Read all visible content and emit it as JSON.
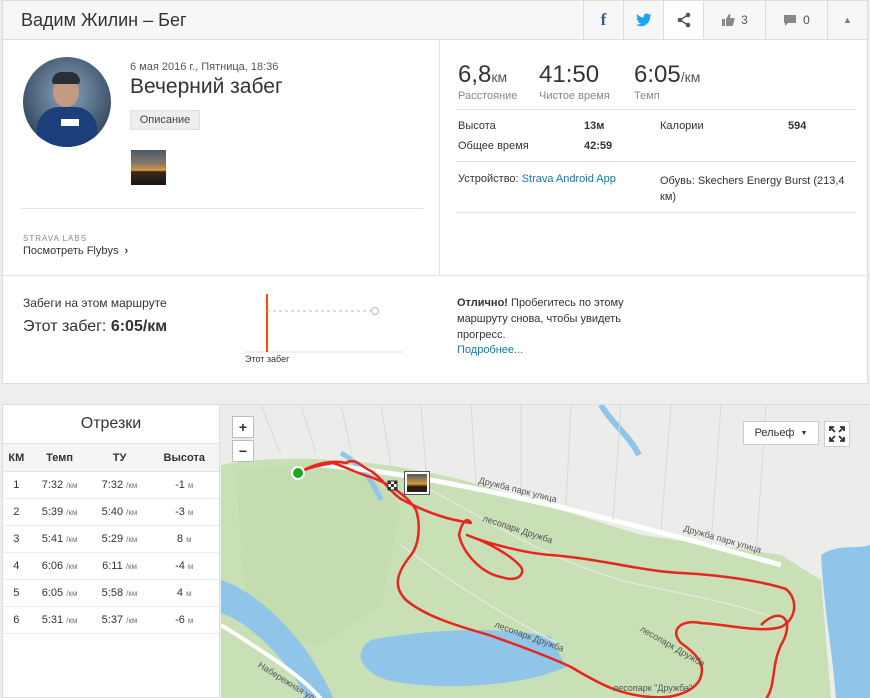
{
  "header": {
    "title": "Вадим Жилин – Бег",
    "kudos_count": "3",
    "comments_count": "0"
  },
  "activity": {
    "date": "6 мая 2016 г., Пятница, 18:36",
    "name": "Вечерний забег",
    "description_button": "Описание",
    "strava_labs": "STRAVA LABS",
    "flybys_link": "Посмотреть Flybys"
  },
  "stats": {
    "distance": {
      "value": "6,8",
      "unit": "км",
      "label": "Расстояние"
    },
    "moving_time": {
      "value": "41:50",
      "label": "Чистое время"
    },
    "pace": {
      "value": "6:05",
      "unit": "/км",
      "label": "Темп"
    },
    "elevation": {
      "label": "Высота",
      "value": "13м"
    },
    "elapsed": {
      "label": "Общее время",
      "value": "42:59"
    },
    "calories": {
      "label": "Калории",
      "value": "594"
    },
    "device": {
      "label": "Устройство:",
      "value": "Strava Android App"
    },
    "shoes": {
      "label": "Обувь:",
      "value": "Skechers Energy Burst (213,4 км)"
    }
  },
  "route": {
    "label": "Забеги на этом маршруте",
    "this_run_label": "Этот забег:",
    "this_run_value": "6:05/км",
    "chart_label": "Этот забег",
    "note_bold": "Отлично!",
    "note_text": "Пробегитесь по этому маршруту снова, чтобы увидеть прогресс.",
    "more_link": "Подробнее..."
  },
  "splits": {
    "title": "Отрезки",
    "headers": [
      "КМ",
      "Темп",
      "ТУ",
      "Высота"
    ],
    "rows": [
      {
        "km": "1",
        "pace": "7:32",
        "gap": "7:32",
        "elev": "-1"
      },
      {
        "km": "2",
        "pace": "5:39",
        "gap": "5:40",
        "elev": "-3"
      },
      {
        "km": "3",
        "pace": "5:41",
        "gap": "5:29",
        "elev": "8"
      },
      {
        "km": "4",
        "pace": "6:06",
        "gap": "6:11",
        "elev": "-4"
      },
      {
        "km": "5",
        "pace": "6:05",
        "gap": "5:58",
        "elev": "4"
      },
      {
        "km": "6",
        "pace": "5:31",
        "gap": "5:37",
        "elev": "-6"
      }
    ],
    "pace_unit": "/км",
    "elev_unit": "м"
  },
  "map": {
    "zoom_in": "+",
    "zoom_out": "−",
    "layer": "Рельеф",
    "labels": {
      "street1": "Дружба парк улица",
      "street2": "Дружба парк улица",
      "park1": "лесопарк Дружба",
      "park2": "лесопарк Дружба",
      "park3": "лесопарк Дружба",
      "park4": "лесопарк \"Дружба\"",
      "embankment": "Набережная ул"
    },
    "colors": {
      "route": "#e8261f",
      "water": "#8fc5e8",
      "park": "#c9dfb6",
      "land": "#ececea"
    }
  },
  "colors": {
    "accent": "#fc4c02",
    "link": "#1a77a7"
  }
}
